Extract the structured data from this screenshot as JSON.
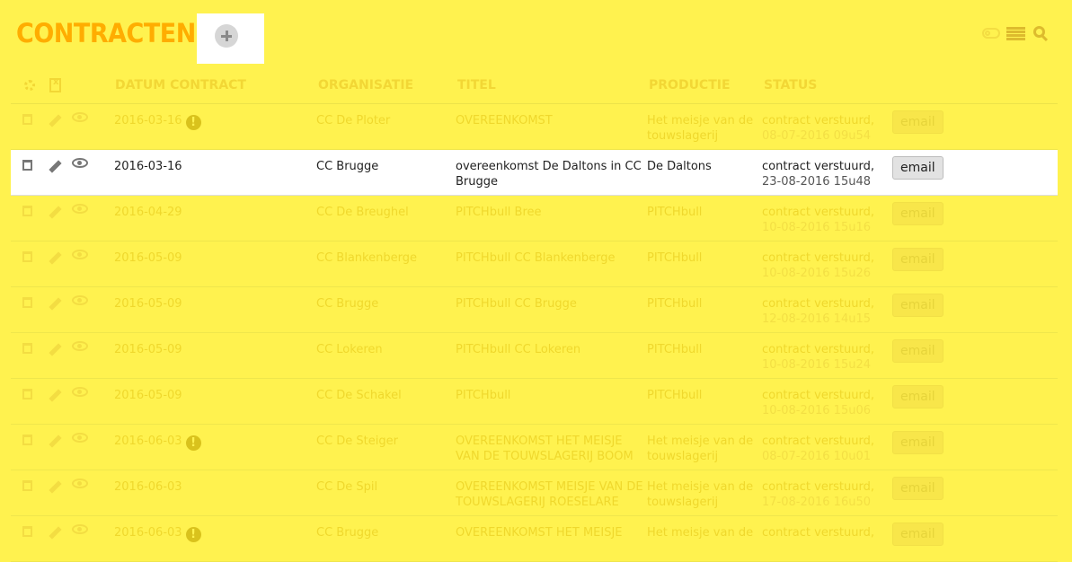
{
  "header": {
    "title": "CONTRACTEN"
  },
  "table": {
    "columns": [
      "DATUM CONTRACT",
      "ORGANISATIE",
      "TITEL",
      "PRODUCTIE",
      "STATUS"
    ],
    "rows": [
      {
        "date": "2016-03-16",
        "warn": true,
        "org": "CC De Ploter",
        "title": "OVEREENKOMST",
        "prod": "Het meisje van de touwslagerij",
        "status": "contract verstuurd,",
        "ts": "08-07-2016 09u54",
        "email": "email"
      },
      {
        "date": "2016-03-16",
        "warn": false,
        "org": "CC Brugge",
        "title": "overeenkomst De Daltons in CC Brugge",
        "prod": "De Daltons",
        "status": "contract verstuurd,",
        "ts": "23-08-2016 15u48",
        "email": "email"
      },
      {
        "date": "2016-04-29",
        "warn": false,
        "org": "CC De Breughel",
        "title": "PITCHbull Bree",
        "prod": "PITCHbull",
        "status": "contract verstuurd,",
        "ts": "10-08-2016 15u16",
        "email": "email"
      },
      {
        "date": "2016-05-09",
        "warn": false,
        "org": "CC Blankenberge",
        "title": "PITCHbull CC Blankenberge",
        "prod": "PITCHbull",
        "status": "contract verstuurd,",
        "ts": "10-08-2016 15u26",
        "email": "email"
      },
      {
        "date": "2016-05-09",
        "warn": false,
        "org": "CC Brugge",
        "title": "PITCHbull CC Brugge",
        "prod": "PITCHbull",
        "status": "contract verstuurd,",
        "ts": "12-08-2016 14u15",
        "email": "email"
      },
      {
        "date": "2016-05-09",
        "warn": false,
        "org": "CC Lokeren",
        "title": "PITCHbull CC Lokeren",
        "prod": "PITCHbull",
        "status": "contract verstuurd,",
        "ts": "10-08-2016 15u24",
        "email": "email"
      },
      {
        "date": "2016-05-09",
        "warn": false,
        "org": "CC De Schakel",
        "title": "PITCHbull",
        "prod": "PITCHbull",
        "status": "contract verstuurd,",
        "ts": "10-08-2016 15u06",
        "email": "email"
      },
      {
        "date": "2016-06-03",
        "warn": true,
        "org": "CC De Steiger",
        "title": "OVEREENKOMST HET MEISJE VAN DE TOUWSLAGERIJ BOOM",
        "prod": "Het meisje van de touwslagerij",
        "status": "contract verstuurd,",
        "ts": "08-07-2016 10u01",
        "email": "email"
      },
      {
        "date": "2016-06-03",
        "warn": false,
        "org": "CC De Spil",
        "title": "OVEREENKOMST MEISJE VAN DE TOUWSLAGERIJ ROESELARE",
        "prod": "Het meisje van de touwslagerij",
        "status": "contract verstuurd,",
        "ts": "17-08-2016 16u50",
        "email": "email"
      },
      {
        "date": "2016-06-03",
        "warn": true,
        "org": "CC Brugge",
        "title": "OVEREENKOMST HET MEISJE",
        "prod": "Het meisje van de",
        "status": "contract verstuurd,",
        "ts": "",
        "email": "email"
      }
    ]
  },
  "warn_symbol": "!",
  "colors": {
    "background": "#fff24f",
    "title": "#ffad00",
    "highlight_row": "#ffffff"
  }
}
